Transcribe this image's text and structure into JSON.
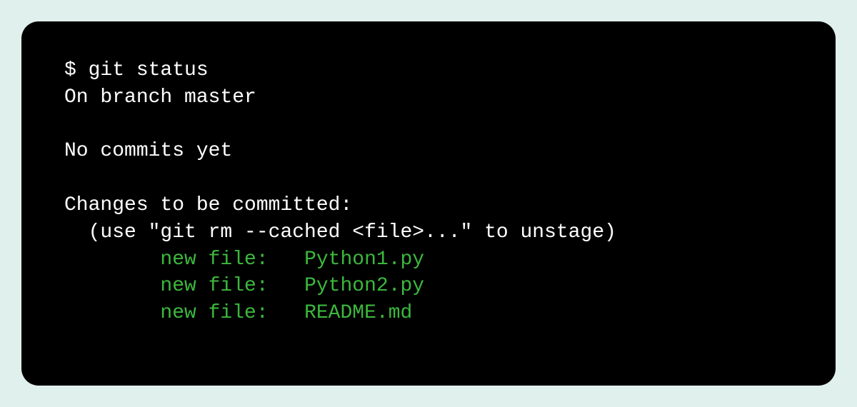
{
  "terminal": {
    "prompt": "$ ",
    "command": "git status",
    "output": {
      "branch_line": "On branch master",
      "commits_line": "No commits yet",
      "changes_header": "Changes to be committed:",
      "unstage_hint": "  (use \"git rm --cached <file>...\" to unstage)",
      "files": [
        {
          "status": "new file:",
          "name": "Python1.py"
        },
        {
          "status": "new file:",
          "name": "Python2.py"
        },
        {
          "status": "new file:",
          "name": "README.md"
        }
      ]
    }
  }
}
